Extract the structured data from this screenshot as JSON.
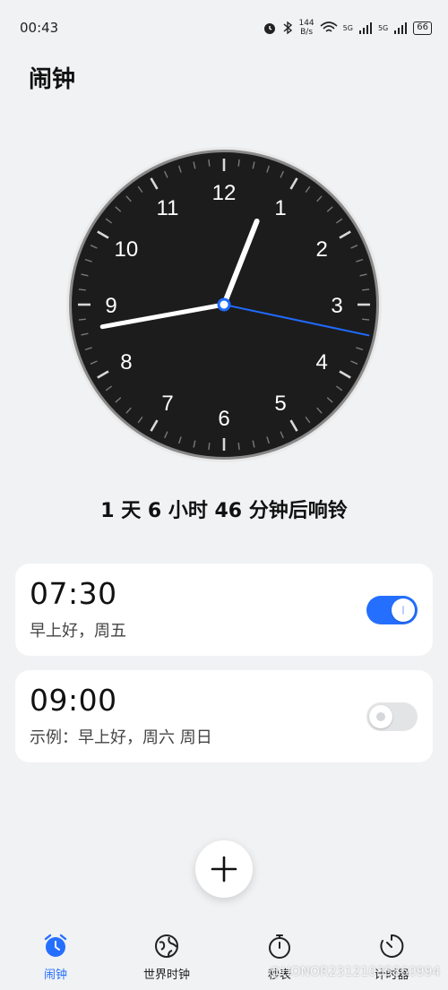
{
  "status_bar": {
    "time": "00:43",
    "net_speed_value": "144",
    "net_speed_unit": "B/s",
    "signal_1_label": "5G",
    "signal_2_label": "5G",
    "battery": "66"
  },
  "page_title": "闹钟",
  "analog_clock": {
    "numerals": [
      "12",
      "1",
      "2",
      "3",
      "4",
      "5",
      "6",
      "7",
      "8",
      "9",
      "10",
      "11"
    ],
    "hour": 0,
    "minute": 43,
    "second": 17,
    "second_hand_color": "#1f6bff"
  },
  "next_alarm_text": "1 天 6 小时 46 分钟后响铃",
  "alarms": [
    {
      "time": "07:30",
      "label": "早上好，周五",
      "enabled": true
    },
    {
      "time": "09:00",
      "label": "示例：早上好，周六 周日",
      "enabled": false
    }
  ],
  "add_button": {
    "icon": "plus-icon"
  },
  "bottom_nav": [
    {
      "label": "闹钟",
      "icon": "alarm-clock-icon",
      "active": true
    },
    {
      "label": "世界时钟",
      "icon": "globe-icon",
      "active": false
    },
    {
      "label": "秒表",
      "icon": "stopwatch-icon",
      "active": false
    },
    {
      "label": "计时器",
      "icon": "timer-icon",
      "active": false
    }
  ],
  "watermark": "@HONOR23121035860994",
  "colors": {
    "accent": "#256fff",
    "background": "#f1f2f4",
    "card": "#ffffff",
    "clock_face": "#1c1c1c"
  }
}
